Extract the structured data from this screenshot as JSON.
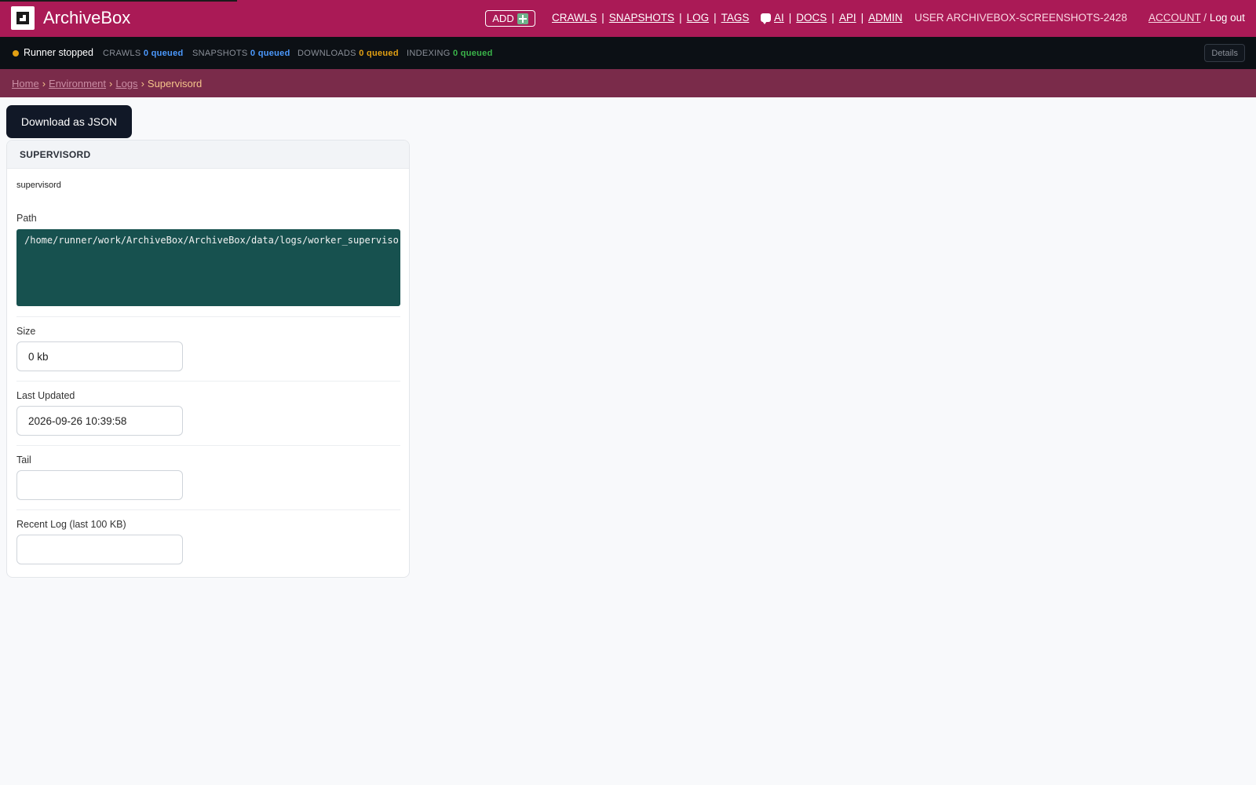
{
  "header": {
    "brand": "ArchiveBox",
    "add_label": "ADD",
    "nav_main": [
      "CRAWLS",
      "SNAPSHOTS",
      "LOG",
      "TAGS"
    ],
    "nav_tools": [
      "AI",
      "DOCS",
      "API",
      "ADMIN"
    ],
    "user_label": "USER ARCHIVEBOX-SCREENSHOTS-2428",
    "account_label": "ACCOUNT",
    "account_sep": "/",
    "logout_label": "Log out",
    "sep": "|"
  },
  "status": {
    "runner": "Runner stopped",
    "crawls_label": "CRAWLS",
    "crawls_value": "0 queued",
    "snapshots_label": "SNAPSHOTS",
    "snapshots_value": "0 queued",
    "downloads_label": "DOWNLOADS",
    "downloads_value": "0 queued",
    "indexing_label": "INDEXING",
    "indexing_value": "0 queued",
    "details_label": "Details"
  },
  "breadcrumb": {
    "home": "Home",
    "environment": "Environment",
    "logs": "Logs",
    "current": "Supervisord",
    "arrow": "›"
  },
  "download_label": "Download as JSON",
  "card": {
    "title": "SUPERVISORD",
    "description": "supervisord",
    "path_label": "Path",
    "path_value": "/home/runner/work/ArchiveBox/ArchiveBox/data/logs/worker_supervisord.log",
    "size_label": "Size",
    "size_value": "0 kb",
    "updated_label": "Last Updated",
    "updated_value": "2026-09-26 10:39:58",
    "tail_label": "Tail",
    "tail_value": "",
    "recent_label": "Recent Log (last 100 KB)",
    "recent_value": ""
  },
  "colors": {
    "header_bg": "#aa1a56",
    "status_bg": "#0c1015",
    "breadcrumb_bg": "#7a2b4a",
    "path_bg": "#17514f"
  }
}
